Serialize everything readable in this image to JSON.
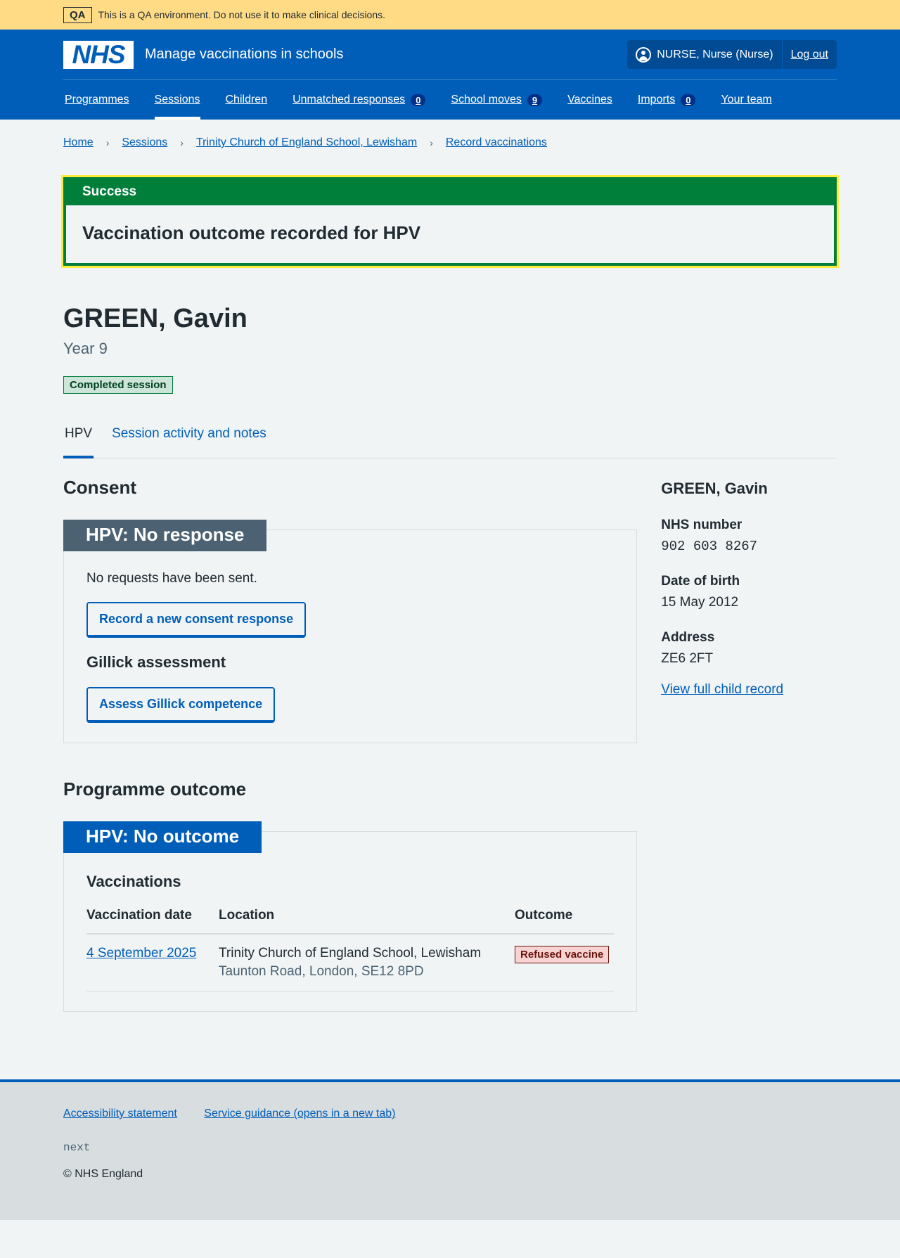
{
  "qa": {
    "tag": "QA",
    "message": "This is a QA environment. Do not use it to make clinical decisions."
  },
  "header": {
    "logo": "NHS",
    "service_name": "Manage vaccinations in schools",
    "user": "NURSE, Nurse (Nurse)",
    "logout": "Log out"
  },
  "nav": {
    "programmes": "Programmes",
    "sessions": "Sessions",
    "children": "Children",
    "unmatched": "Unmatched responses",
    "unmatched_count": "0",
    "school_moves": "School moves",
    "school_moves_count": "9",
    "vaccines": "Vaccines",
    "imports": "Imports",
    "imports_count": "0",
    "team": "Your team"
  },
  "breadcrumb": {
    "home": "Home",
    "sessions": "Sessions",
    "school": "Trinity Church of England School, Lewisham",
    "record": "Record vaccinations"
  },
  "banner": {
    "title": "Success",
    "message": "Vaccination outcome recorded for HPV"
  },
  "child": {
    "name": "GREEN, Gavin",
    "year": "Year 9",
    "status_tag": "Completed session"
  },
  "tabs": {
    "hpv": "HPV",
    "activity": "Session activity and notes"
  },
  "consent": {
    "heading": "Consent",
    "card_title": "HPV: No response",
    "text": "No requests have been sent.",
    "record_button": "Record a new consent response",
    "gillick_heading": "Gillick assessment",
    "gillick_button": "Assess Gillick competence"
  },
  "outcome": {
    "heading": "Programme outcome",
    "card_title": "HPV: No outcome",
    "vacc_heading": "Vaccinations",
    "columns": {
      "date": "Vaccination date",
      "location": "Location",
      "outcome": "Outcome"
    },
    "rows": [
      {
        "date": "4 September 2025",
        "location": "Trinity Church of England School, Lewisham",
        "address": "Taunton Road, London, SE12 8PD",
        "outcome": "Refused vaccine"
      }
    ]
  },
  "sidebar": {
    "name": "GREEN, Gavin",
    "nhs_label": "NHS number",
    "nhs_value": "902 603 8267",
    "dob_label": "Date of birth",
    "dob_value": "15 May 2012",
    "address_label": "Address",
    "address_value": "ZE6 2FT",
    "link": "View full child record"
  },
  "footer": {
    "accessibility": "Accessibility statement",
    "guidance": "Service guidance (opens in a new tab)",
    "version": "next",
    "copyright": "© NHS England"
  },
  "colors": {
    "nhs_blue": "#005eb8",
    "success_green": "#007f3b",
    "qa_yellow": "#ffdb85",
    "focus_yellow": "#ffeb3b"
  }
}
